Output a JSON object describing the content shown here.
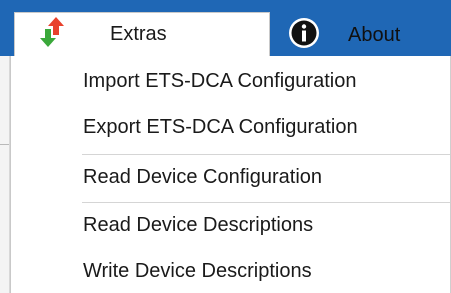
{
  "tabs": {
    "extras": {
      "label": "Extras",
      "icon": "transfer-arrows-icon"
    },
    "about": {
      "label": "About",
      "icon": "info-icon"
    }
  },
  "menu": {
    "items": [
      {
        "label": "Import ETS-DCA Configuration"
      },
      {
        "label": "Export ETS-DCA Configuration"
      },
      {
        "label": "Read Device Configuration"
      },
      {
        "label": "Read Device Descriptions"
      },
      {
        "label": "Write Device Descriptions"
      }
    ]
  },
  "colors": {
    "ribbon": "#1f67b5",
    "arrow_up": "#e8412c",
    "arrow_down": "#3aa83a"
  }
}
